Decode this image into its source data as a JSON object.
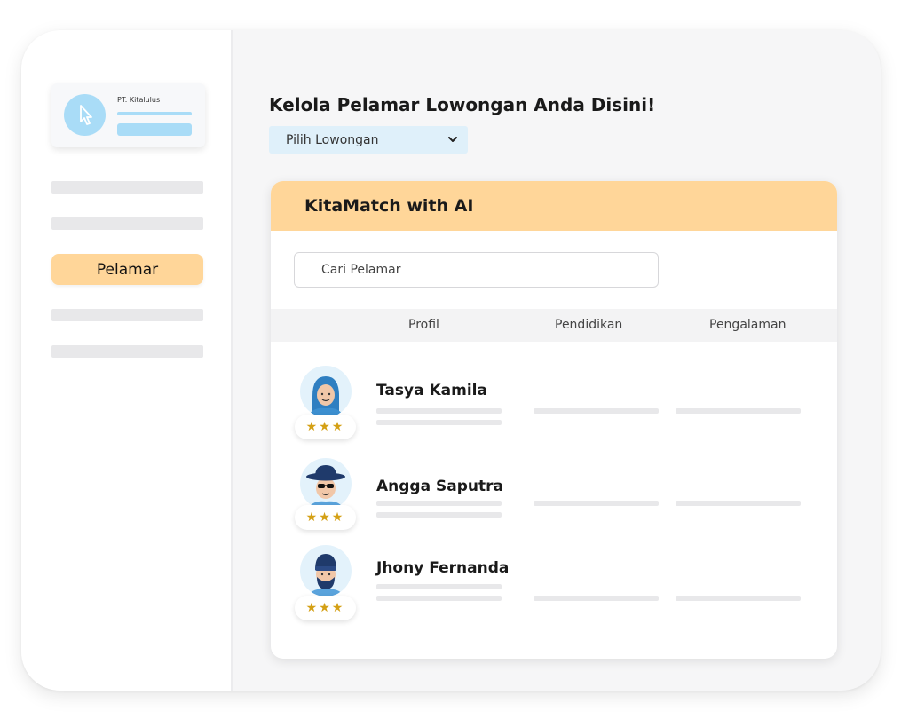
{
  "sidebar": {
    "company_name": "PT. Kitalulus",
    "active_item": "Pelamar"
  },
  "main": {
    "title": "Kelola Pelamar Lowongan Anda Disini!",
    "job_select": {
      "value": "Pilih Lowongan"
    }
  },
  "panel": {
    "title": "KitaMatch with AI",
    "search_placeholder": "Cari Pelamar",
    "columns": [
      "Profil",
      "Pendidikan",
      "Pengalaman"
    ],
    "applicants": [
      {
        "name": "Tasya Kamila",
        "stars": "★★★",
        "rating": 3
      },
      {
        "name": "Angga Saputra",
        "stars": "★★★",
        "rating": 3
      },
      {
        "name": "Jhony Fernanda",
        "stars": "★★★",
        "rating": 3
      }
    ]
  },
  "colors": {
    "accent": "#ffd699",
    "light_blue": "#a9dcf7",
    "select_bg": "#dff0fa",
    "star": "#d4a015"
  }
}
